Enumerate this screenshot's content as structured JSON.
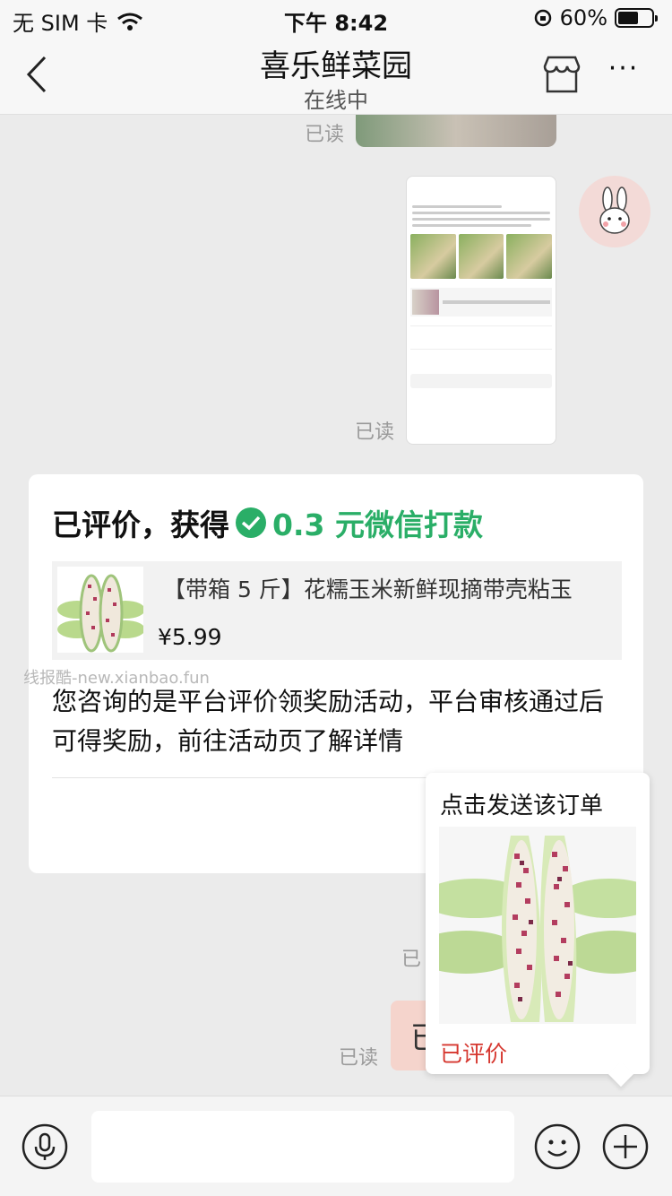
{
  "status_bar": {
    "carrier": "无 SIM 卡",
    "time": "下午 8:42",
    "battery": "60%",
    "battery_level": 0.6,
    "icons": [
      "wifi-icon",
      "rotation-lock-icon",
      "battery-icon"
    ]
  },
  "header": {
    "title": "喜乐鲜菜园",
    "subtitle": "在线中",
    "icons": [
      "back-arrow-icon",
      "store-icon",
      "more-icon"
    ]
  },
  "messages": {
    "read_label": "已读"
  },
  "card": {
    "head_prefix": "已评价，获得",
    "head_amount": "0.3 元微信打款",
    "product_name": "【带箱 5 斤】花糯玉米新鲜现摘带壳粘玉",
    "product_price": "¥5.99",
    "body": "您咨询的是平台评价领奖励活动，平台审核通过后可得奖励，前往活动页了解详情"
  },
  "watermark": "线报酷-new.xianbao.fun",
  "popup": {
    "title": "点击发送该订单",
    "status": "已评价"
  },
  "sent_bubble_char": "已",
  "input_bar": {
    "icons": [
      "voice-icon",
      "emoji-icon",
      "plus-icon"
    ]
  },
  "colors": {
    "accent_green": "#2aae67",
    "status_red": "#d6372f",
    "background": "#ebebeb"
  }
}
